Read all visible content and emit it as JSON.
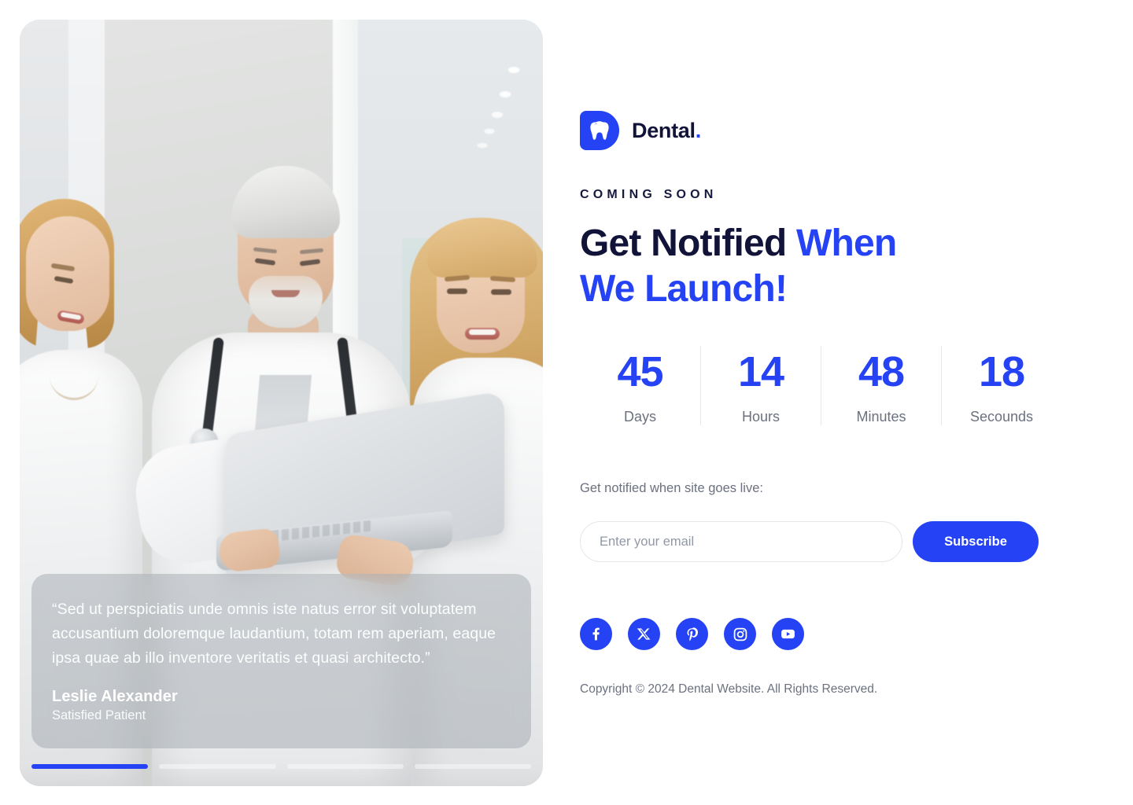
{
  "brand": {
    "name": "Dental",
    "dot": ".",
    "logo_icon": "tooth-icon",
    "accent_color": "#2543F5",
    "dark_color": "#111339"
  },
  "hero": {
    "image_alt": "Three dental clinic staff members viewing a laptop in a bright corridor",
    "testimonial": {
      "quote": "“Sed ut perspiciatis unde omnis iste natus error sit voluptatem accusantium doloremque laudantium, totam rem aperiam, eaque ipsa quae ab illo inventore veritatis et quasi architecto.”",
      "name": "Leslie Alexander",
      "role": "Satisfied Patient"
    },
    "slider": {
      "total": 4,
      "active_index": 1,
      "bars": [
        "active",
        "inactive",
        "inactive",
        "inactive"
      ]
    }
  },
  "main": {
    "eyebrow": "COMING SOON",
    "headline_line1_dark": "Get Notified ",
    "headline_line1_accent": "When",
    "headline_line2_accent": "We Launch!",
    "countdown": [
      {
        "value": "45",
        "label": "Days"
      },
      {
        "value": "14",
        "label": "Hours"
      },
      {
        "value": "48",
        "label": "Minutes"
      },
      {
        "value": "18",
        "label": "Secounds"
      }
    ],
    "notify_label": "Get notified when site goes live:",
    "email_placeholder": "Enter your email",
    "email_value": "",
    "subscribe_label": "Subscribe",
    "socials": [
      {
        "name": "facebook",
        "icon": "facebook-icon"
      },
      {
        "name": "x-twitter",
        "icon": "x-twitter-icon"
      },
      {
        "name": "pinterest",
        "icon": "pinterest-icon"
      },
      {
        "name": "instagram",
        "icon": "instagram-icon"
      },
      {
        "name": "youtube",
        "icon": "youtube-icon"
      }
    ],
    "copyright": "Copyright © 2024 Dental Website. All Rights Reserved."
  }
}
